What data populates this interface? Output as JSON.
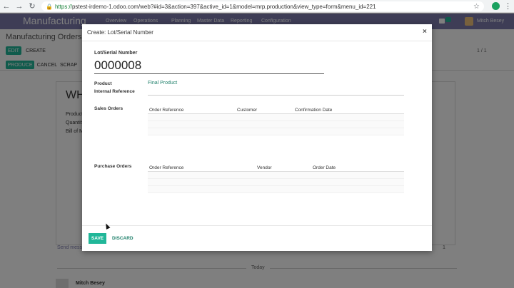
{
  "browser": {
    "url_scheme": "https://",
    "url_rest": "pstest-irdemo-1.odoo.com/web?#id=3&action=397&active_id=1&model=mrp.production&view_type=form&menu_id=221",
    "back_icon": "arrow-left-icon",
    "forward_icon": "arrow-right-icon",
    "reload_icon": "reload-icon",
    "lock_icon": "lock-icon",
    "star_icon": "star-icon"
  },
  "app": {
    "name": "Manufacturing",
    "menus": [
      "Overview",
      "Operations",
      "Planning",
      "Master Data",
      "Reporting",
      "Configuration"
    ],
    "user": "Mitch Besey",
    "breadcrumb": "Manufacturing Orders / W",
    "edit_label": "EDIT",
    "create_label": "CREATE",
    "produce_label": "PRODUCE",
    "cancel_label": "CANCEL",
    "scrap_label": "SCRAP",
    "pager": "1 / 1",
    "record_title": "WH",
    "fields": [
      "Product",
      "Quantity",
      "Bill of M"
    ],
    "chatter_send": "Send messa",
    "today_label": "Today",
    "message_author": "Mitch Besey",
    "follower_count": "1",
    "accent_color": "#7c7bad"
  },
  "modal": {
    "title": "Create: Lot/Serial Number",
    "close_label": "×",
    "lot_label": "Lot/Serial Number",
    "lot_value": "0000008",
    "product_label": "Product",
    "product_value": "Final Product",
    "internal_ref_label": "Internal Reference",
    "sales_orders_label": "Sales Orders",
    "sales_columns": [
      "Order Reference",
      "Customer",
      "Confirmation Date"
    ],
    "purchase_orders_label": "Purchase Orders",
    "purchase_columns": [
      "Order Reference",
      "Vendor",
      "Order Date"
    ],
    "save_label": "SAVE",
    "discard_label": "DISCARD",
    "primary_color": "#21b799",
    "link_color": "#21816c"
  }
}
